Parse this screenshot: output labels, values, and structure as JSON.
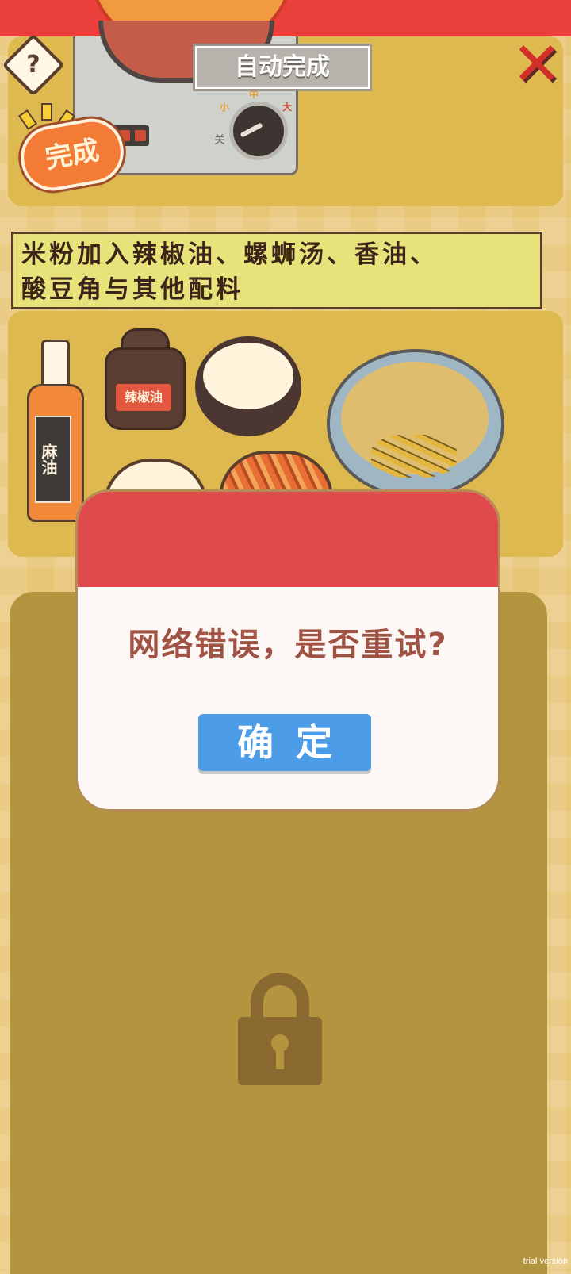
{
  "stove": {
    "auto_complete_label": "自动完成",
    "knob_small": "小",
    "knob_medium": "中",
    "knob_large": "大",
    "knob_off": "关"
  },
  "top_bar": {
    "help_label": "?",
    "close_label": "✕"
  },
  "done_badge": "完成",
  "instruction": {
    "line1": "米粉加入辣椒油、螺蛳汤、香油、",
    "line2": "酸豆角与其他配料"
  },
  "ingredients": {
    "bottle_label": "麻油",
    "jar_label": "辣椒油"
  },
  "dialog": {
    "message": "网络错误，是否重试?",
    "confirm_label": "确定"
  },
  "watermark": "trial version",
  "colors": {
    "banner_red": "#ea3f3a",
    "dialog_header": "#df4a4b",
    "confirm_blue": "#4d9ce8",
    "panel_gold": "#b4953f"
  }
}
